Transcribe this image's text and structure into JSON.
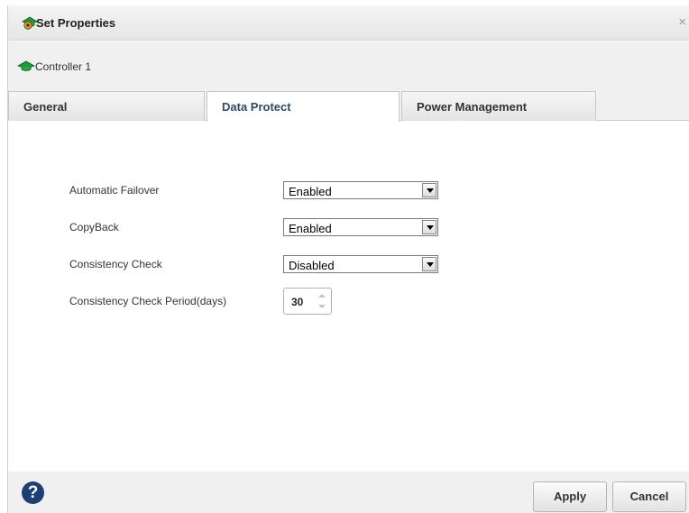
{
  "dialog": {
    "title": "Set Properties",
    "close_glyph": "×",
    "title_icon": "controller-gear-icon"
  },
  "controller": {
    "label": "Controller 1",
    "icon": "controller-icon"
  },
  "tabs": [
    {
      "label": "General",
      "active": false
    },
    {
      "label": "Data Protect",
      "active": true
    },
    {
      "label": "Power Management",
      "active": false
    }
  ],
  "fields": {
    "failover": {
      "label": "Automatic Failover",
      "value": "Enabled"
    },
    "copyback": {
      "label": "CopyBack",
      "value": "Enabled"
    },
    "consistency": {
      "label": "Consistency Check",
      "value": "Disabled"
    },
    "period": {
      "label": "Consistency Check Period(days)",
      "value": "30"
    }
  },
  "footer": {
    "help_glyph": "?",
    "apply_label": "Apply",
    "cancel_label": "Cancel"
  },
  "colors": {
    "help_bg": "#1d3f73",
    "icon_green": "#1e9a3a",
    "active_tab_text": "#2a4a6a"
  }
}
